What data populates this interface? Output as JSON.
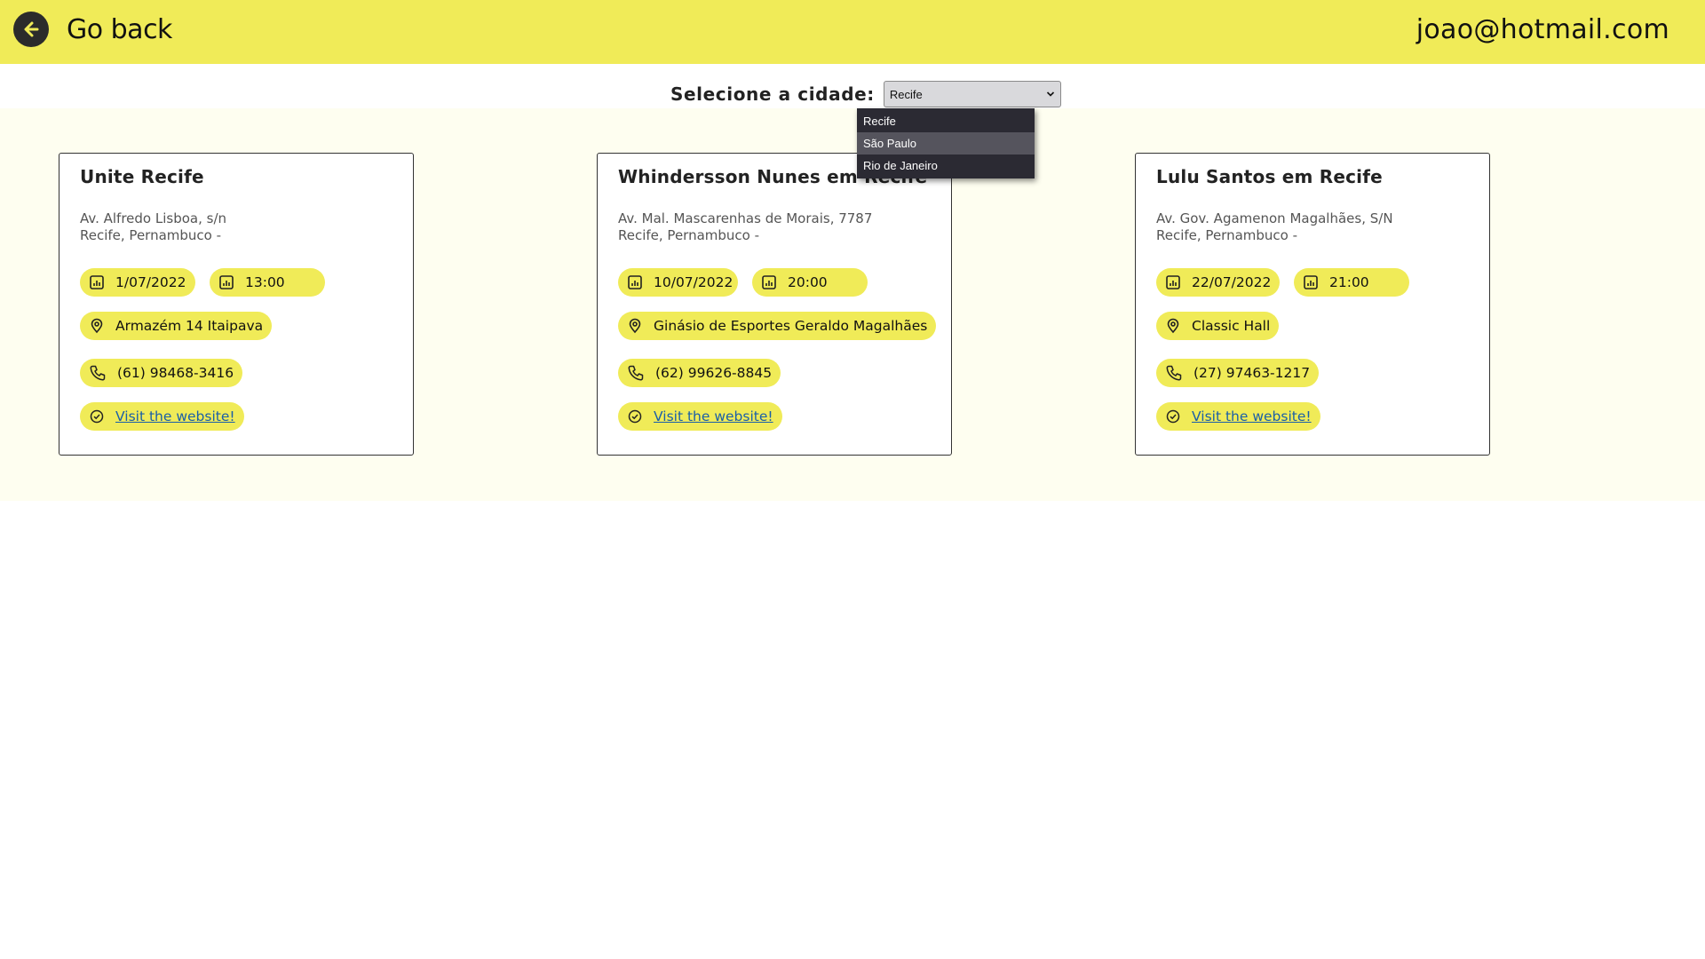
{
  "header": {
    "back_label": "Go back",
    "user_email": "joao@hotmail.com",
    "bar_color": "#f0eb58"
  },
  "city_filter": {
    "label": "Selecione a cidade:",
    "selected": "Recife",
    "options": [
      "Recife",
      "São Paulo",
      "Rio de Janeiro"
    ],
    "hovered": "São Paulo"
  },
  "events": [
    {
      "title": "Unite Recife",
      "address_line1": "Av. Alfredo Lisboa, s/n",
      "address_line2": "Recife, Pernambuco -",
      "date": "1/07/2022",
      "time": "13:00",
      "venue": "Armazém 14 Itaipava",
      "phone": "(61) 98468-3416",
      "website_label": "Visit the website!"
    },
    {
      "title": "Whindersson Nunes em Recife",
      "address_line1": "Av. Mal. Mascarenhas de Morais, 7787",
      "address_line2": "Recife, Pernambuco -",
      "date": "10/07/2022",
      "time": "20:00",
      "venue": "Ginásio de Esportes Geraldo Magalhães",
      "phone": "(62) 99626-8845",
      "website_label": "Visit the website!"
    },
    {
      "title": "Lulu Santos em Recife",
      "address_line1": "Av. Gov. Agamenon Magalhães, S/N",
      "address_line2": "Recife, Pernambuco -",
      "date": "22/07/2022",
      "time": "21:00",
      "venue": "Classic Hall",
      "phone": "(27) 97463-1217",
      "website_label": "Visit the website!"
    }
  ]
}
